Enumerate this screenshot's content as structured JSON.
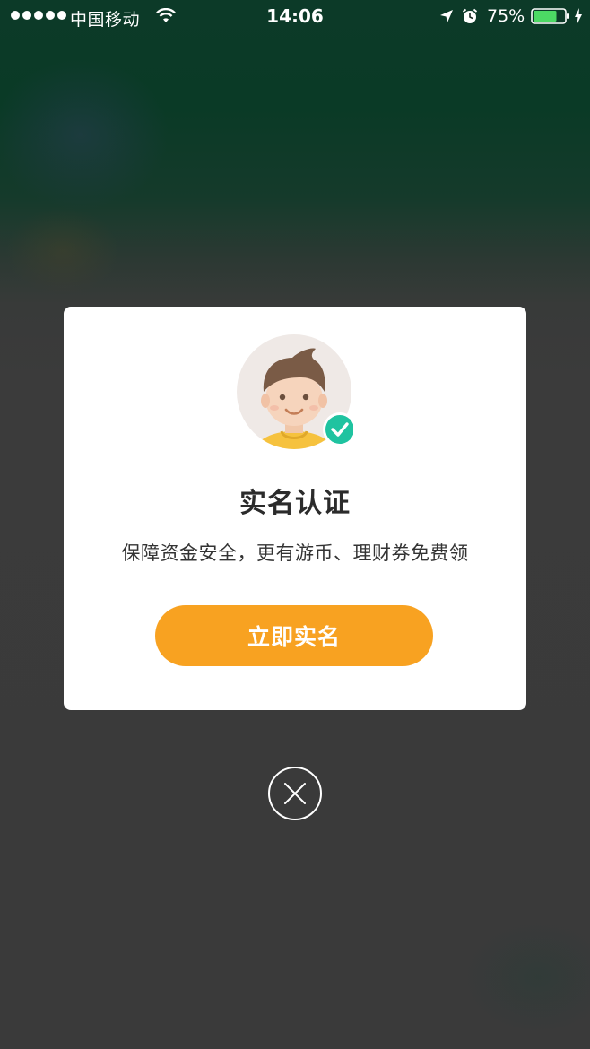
{
  "status_bar": {
    "carrier": "中国移动",
    "time": "14:06",
    "battery_percent": "75%",
    "battery_level": 0.75,
    "icons": [
      "signal-dots",
      "wifi-icon",
      "location-icon",
      "alarm-icon",
      "battery-icon",
      "charging-bolt-icon"
    ]
  },
  "modal": {
    "title": "实名认证",
    "description": "保障资金安全，更有游币、理财券免费领",
    "button_label": "立即实名",
    "avatar_icon": "verified-user-avatar-icon"
  },
  "close_icon": "close-icon",
  "colors": {
    "accent": "#f8a221",
    "check_badge": "#1fc3a0",
    "modal_bg": "#ffffff",
    "overlay": "#3b3b3b"
  }
}
